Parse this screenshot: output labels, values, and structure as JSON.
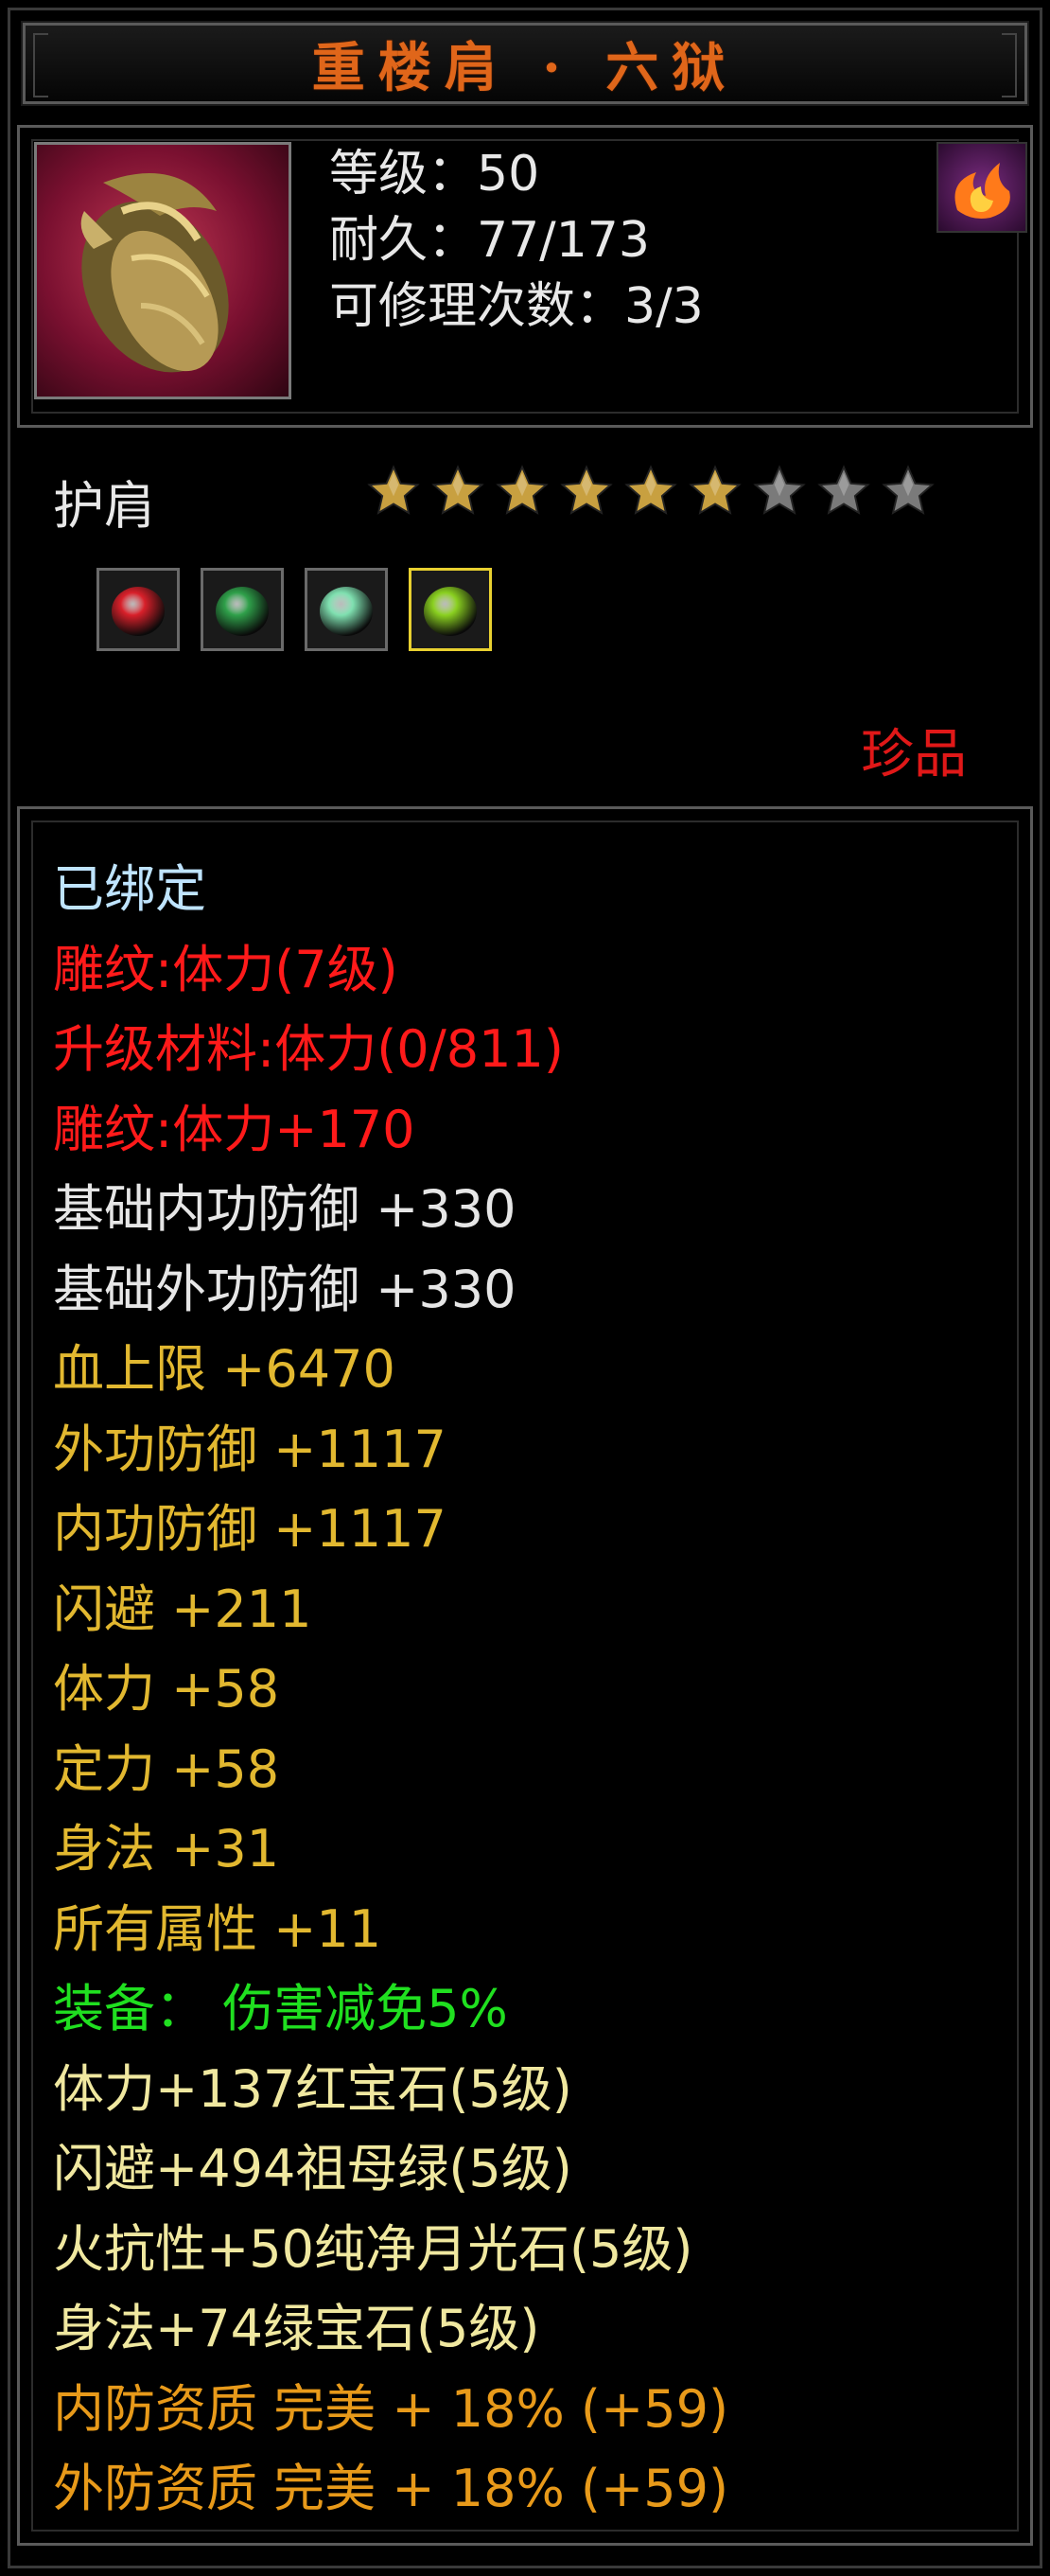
{
  "title": "重楼肩 · 六狱",
  "header": {
    "item_icon": "dragon-shoulder-armor-icon",
    "level": "等级：50",
    "durability": "耐久：77/173",
    "repair_count": "可修理次数：3/3",
    "badge_icon": "flame-emblem-icon"
  },
  "type_label": "护肩",
  "stars": {
    "filled": 6,
    "total": 9
  },
  "gems": [
    {
      "icon": "red-gem-icon",
      "color": "#d8202a"
    },
    {
      "icon": "green-ring-gem-icon",
      "color": "#2fa04a"
    },
    {
      "icon": "moonstone-gem-icon",
      "color": "#7fe0b0"
    },
    {
      "icon": "green-gem-icon",
      "color": "#8ad020",
      "selected": true
    }
  ],
  "rarity": "珍品",
  "attributes": [
    {
      "text": "已绑定",
      "color": "blue"
    },
    {
      "text": "雕纹:体力(7级)",
      "color": "red"
    },
    {
      "text": "升级材料:体力(0/811)",
      "color": "red"
    },
    {
      "text": "雕纹:体力+170",
      "color": "red"
    },
    {
      "text": "基础内功防御 +330",
      "color": "white"
    },
    {
      "text": "基础外功防御 +330",
      "color": "white"
    },
    {
      "text": "血上限 +6470",
      "color": "gold"
    },
    {
      "text": "外功防御 +1117",
      "color": "gold"
    },
    {
      "text": "内功防御 +1117",
      "color": "gold"
    },
    {
      "text": "闪避 +211",
      "color": "gold"
    },
    {
      "text": "体力 +58",
      "color": "gold"
    },
    {
      "text": "定力 +58",
      "color": "gold"
    },
    {
      "text": "身法 +31",
      "color": "gold"
    },
    {
      "text": "所有属性 +11",
      "color": "gold"
    },
    {
      "text": "装备： 伤害减免5%",
      "color": "green"
    },
    {
      "text": "体力+137红宝石(5级)",
      "color": "yellow"
    },
    {
      "text": "闪避+494祖母绿(5级)",
      "color": "yellow"
    },
    {
      "text": "火抗性+50纯净月光石(5级)",
      "color": "yellow"
    },
    {
      "text": "身法+74绿宝石(5级)",
      "color": "yellow"
    },
    {
      "text": "内防资质 完美 + 18% (+59)",
      "color": "orange"
    },
    {
      "text": "外防资质 完美 + 18% (+59)",
      "color": "orange"
    }
  ],
  "colors": {
    "title": "#e0661a",
    "blue": "#bfe4ff",
    "red": "#ff1a1a",
    "white": "#e6e6e6",
    "gold": "#e2b830",
    "green": "#20e020",
    "yellow": "#f0e8a0",
    "orange": "#e89a1a",
    "star_filled": "#c8a040",
    "star_empty": "#7a7a7a"
  }
}
